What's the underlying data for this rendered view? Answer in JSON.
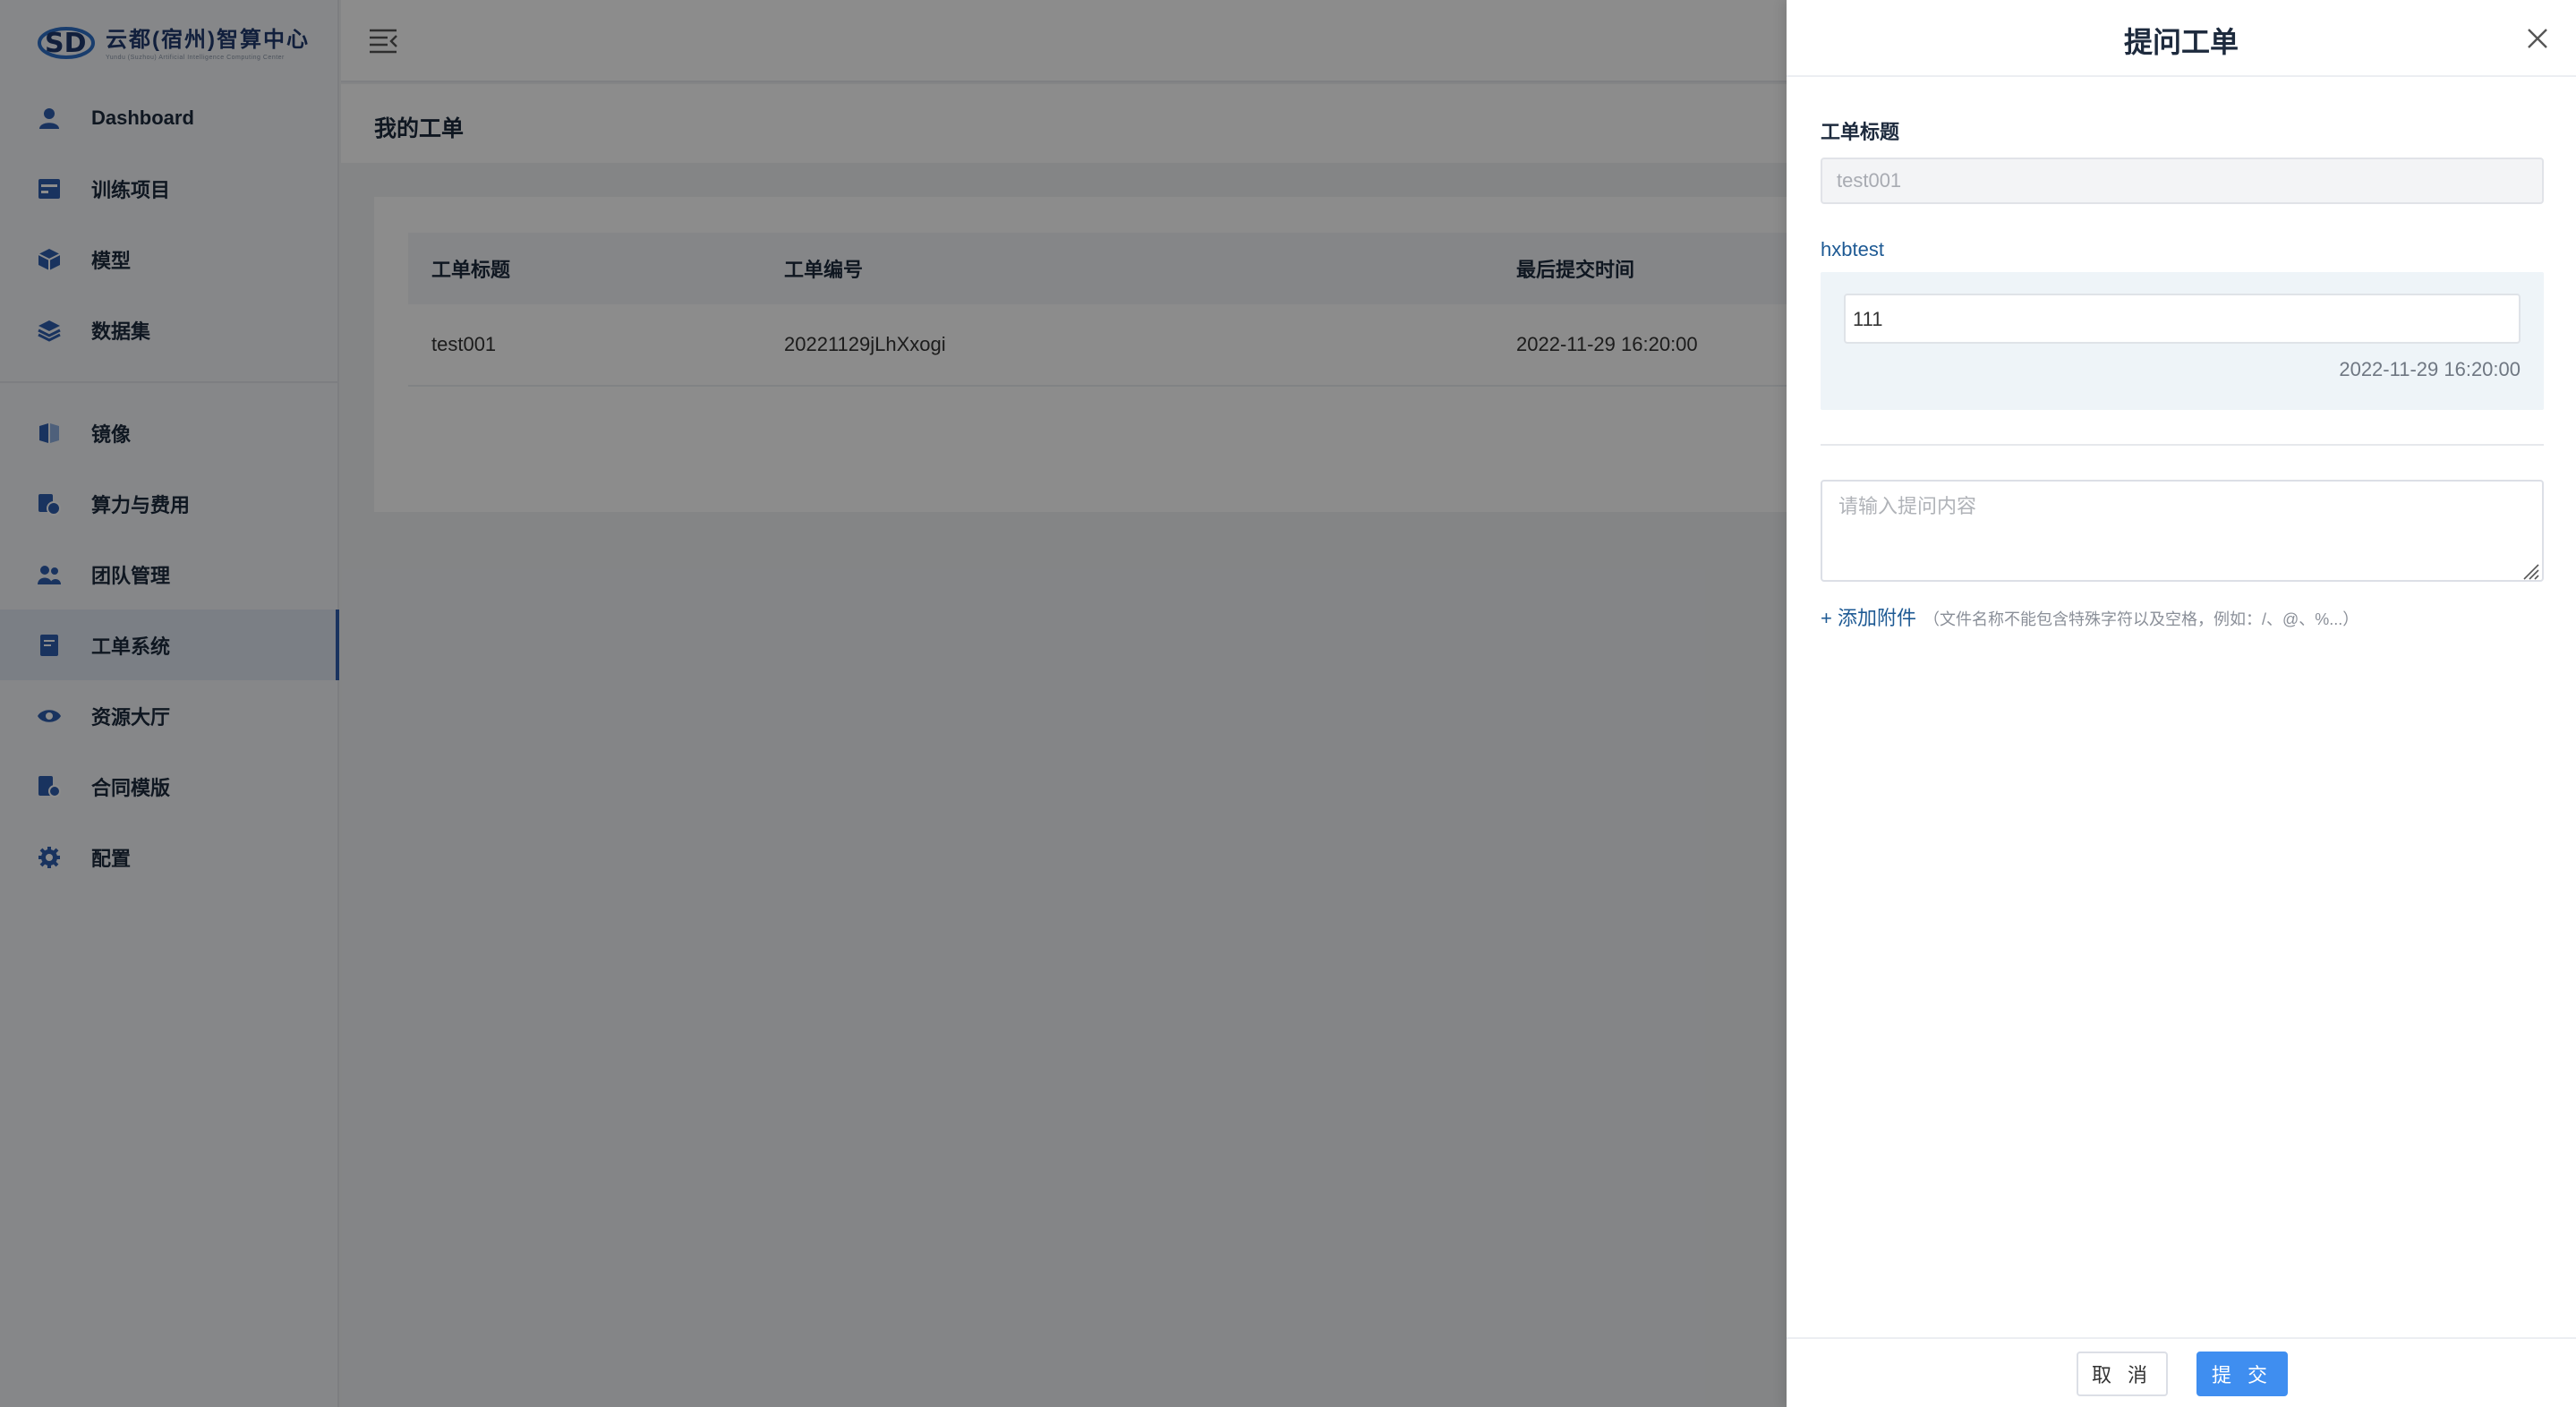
{
  "logo": {
    "title": "云都(宿州)智算中心",
    "subtitle": "Yundu (Suzhou) Artificial Intelligence Computing Center",
    "colors": {
      "primary": "#1f3a6e",
      "accent": "#3f8ef0"
    }
  },
  "sidebar": {
    "items": [
      {
        "label": "Dashboard",
        "icon": "user-icon"
      },
      {
        "label": "训练项目",
        "icon": "list-icon"
      },
      {
        "label": "模型",
        "icon": "cube-icon"
      },
      {
        "label": "数据集",
        "icon": "layers-icon"
      },
      {
        "label": "镜像",
        "icon": "mirror-icon"
      },
      {
        "label": "算力与费用",
        "icon": "billing-icon"
      },
      {
        "label": "团队管理",
        "icon": "team-icon"
      },
      {
        "label": "工单系统",
        "icon": "ticket-icon",
        "active": true
      },
      {
        "label": "资源大厅",
        "icon": "eye-icon"
      },
      {
        "label": "合同模版",
        "icon": "contract-icon"
      },
      {
        "label": "配置",
        "icon": "gear-icon"
      }
    ]
  },
  "page": {
    "title": "我的工单"
  },
  "table": {
    "headers": [
      "工单标题",
      "工单编号",
      "最后提交时间"
    ],
    "rows": [
      {
        "title": "test001",
        "number": "20221129jLhXxogi",
        "time": "2022-11-29 16:20:00"
      }
    ]
  },
  "drawer": {
    "title": "提问工单",
    "field_label": "工单标题",
    "title_value": "test001",
    "message": {
      "author": "hxbtest",
      "content": "111",
      "time": "2022-11-29 16:20:00"
    },
    "reply_placeholder": "请输入提问内容",
    "attach_label": "+ 添加附件",
    "attach_hint": "（文件名称不能包含特殊字符以及空格，例如：/、@、%...）",
    "cancel_label": "取 消",
    "submit_label": "提 交"
  }
}
